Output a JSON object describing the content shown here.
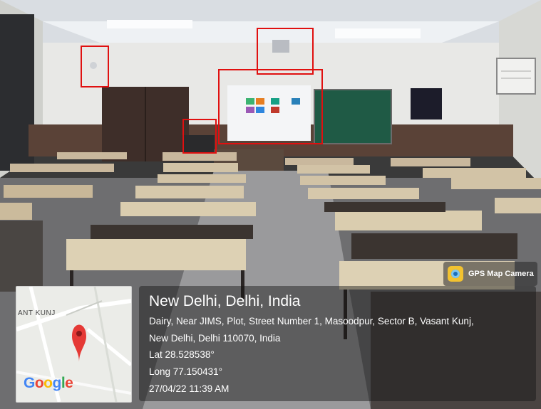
{
  "overlay": {
    "app_badge": {
      "label": "GPS Map Camera",
      "icon": "gps-map-camera-icon"
    },
    "map": {
      "area_label": "ANT KUNJ",
      "logo": "Google",
      "marker_color": "#e53935"
    },
    "location": {
      "title": "New Delhi, Delhi, India",
      "address_line1": "Dairy, Near JIMS, Plot, Street Number 1, Masoodpur, Sector B, Vasant Kunj,",
      "address_line2": "New Delhi, Delhi 110070, India",
      "lat": "Lat 28.528538°",
      "long": "Long 77.150431°",
      "datetime": "27/04/22 11:39 AM"
    }
  },
  "highlight_color": "#e01010"
}
